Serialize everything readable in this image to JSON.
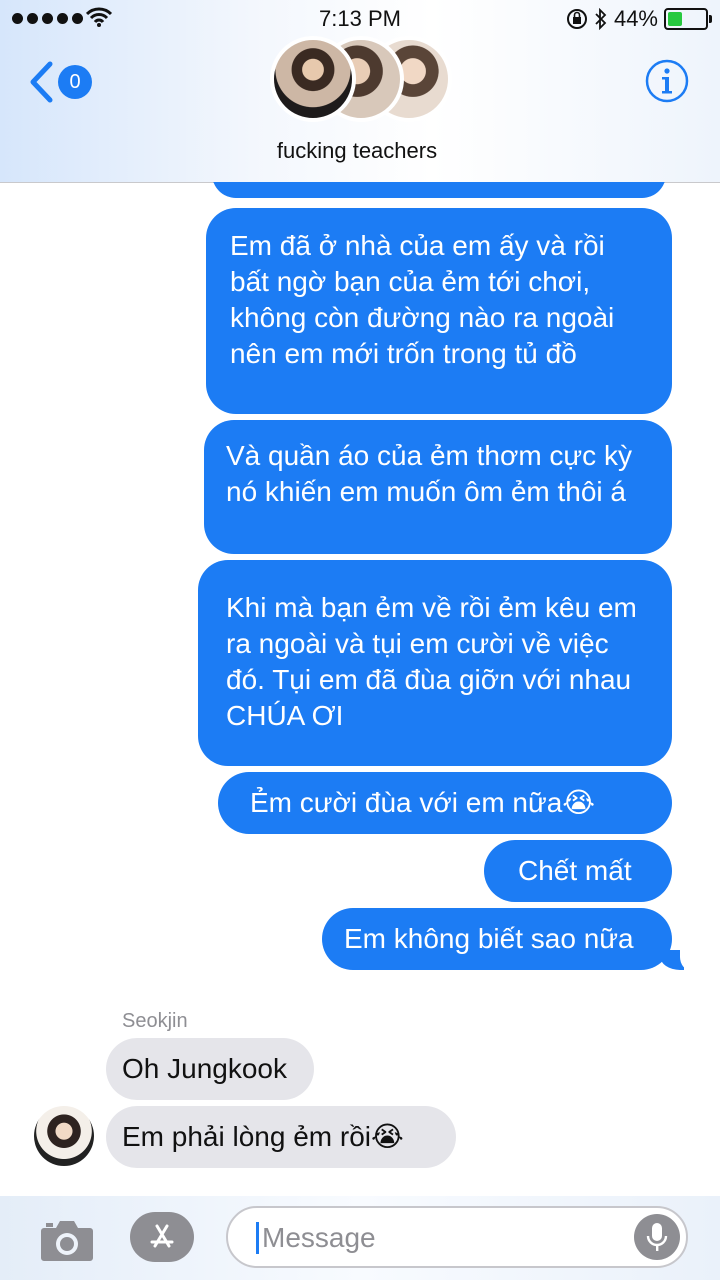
{
  "status_bar": {
    "time": "7:13 PM",
    "battery": "44%",
    "battery_level": 0.44
  },
  "header": {
    "back_badge": "0",
    "group_name": "fucking teachers"
  },
  "messages": [
    {
      "id": "m0",
      "direction": "sent",
      "text": ""
    },
    {
      "id": "m1",
      "direction": "sent",
      "text": "Em đã ở nhà của em ấy và rồi bất ngờ bạn của ẻm tới chơi, không còn đường nào ra ngoài nên em mới trốn trong tủ đồ"
    },
    {
      "id": "m2",
      "direction": "sent",
      "text": "Và quần áo của ẻm thơm cực kỳ nó khiến em muốn ôm ẻm thôi á"
    },
    {
      "id": "m3",
      "direction": "sent",
      "text": "Khi mà bạn ẻm về rồi ẻm kêu em ra ngoài và tụi em cười về việc đó. Tụi em đã đùa giỡn với nhau CHÚA ƠI"
    },
    {
      "id": "m4",
      "direction": "sent",
      "text": "Ẻm cười đùa với em nữa😭"
    },
    {
      "id": "m5",
      "direction": "sent",
      "text": "Chết mất"
    },
    {
      "id": "m6",
      "direction": "sent",
      "text": "Em không biết sao nữa"
    },
    {
      "id": "m7",
      "direction": "received",
      "sender": "Seokjin",
      "text": "Oh Jungkook"
    },
    {
      "id": "m8",
      "direction": "received",
      "text": "Em phải lòng ẻm rồi😭"
    }
  ],
  "input": {
    "placeholder": "Message"
  },
  "colors": {
    "sent_bubble": "#1c7cf4",
    "received_bubble": "#e5e5ea",
    "accent": "#1c7cf4"
  },
  "icons": [
    "back-chevron-icon",
    "info-icon",
    "camera-icon",
    "app-store-icon",
    "microphone-icon",
    "wifi-icon",
    "battery-icon",
    "bluetooth-icon",
    "orientation-lock-icon"
  ]
}
